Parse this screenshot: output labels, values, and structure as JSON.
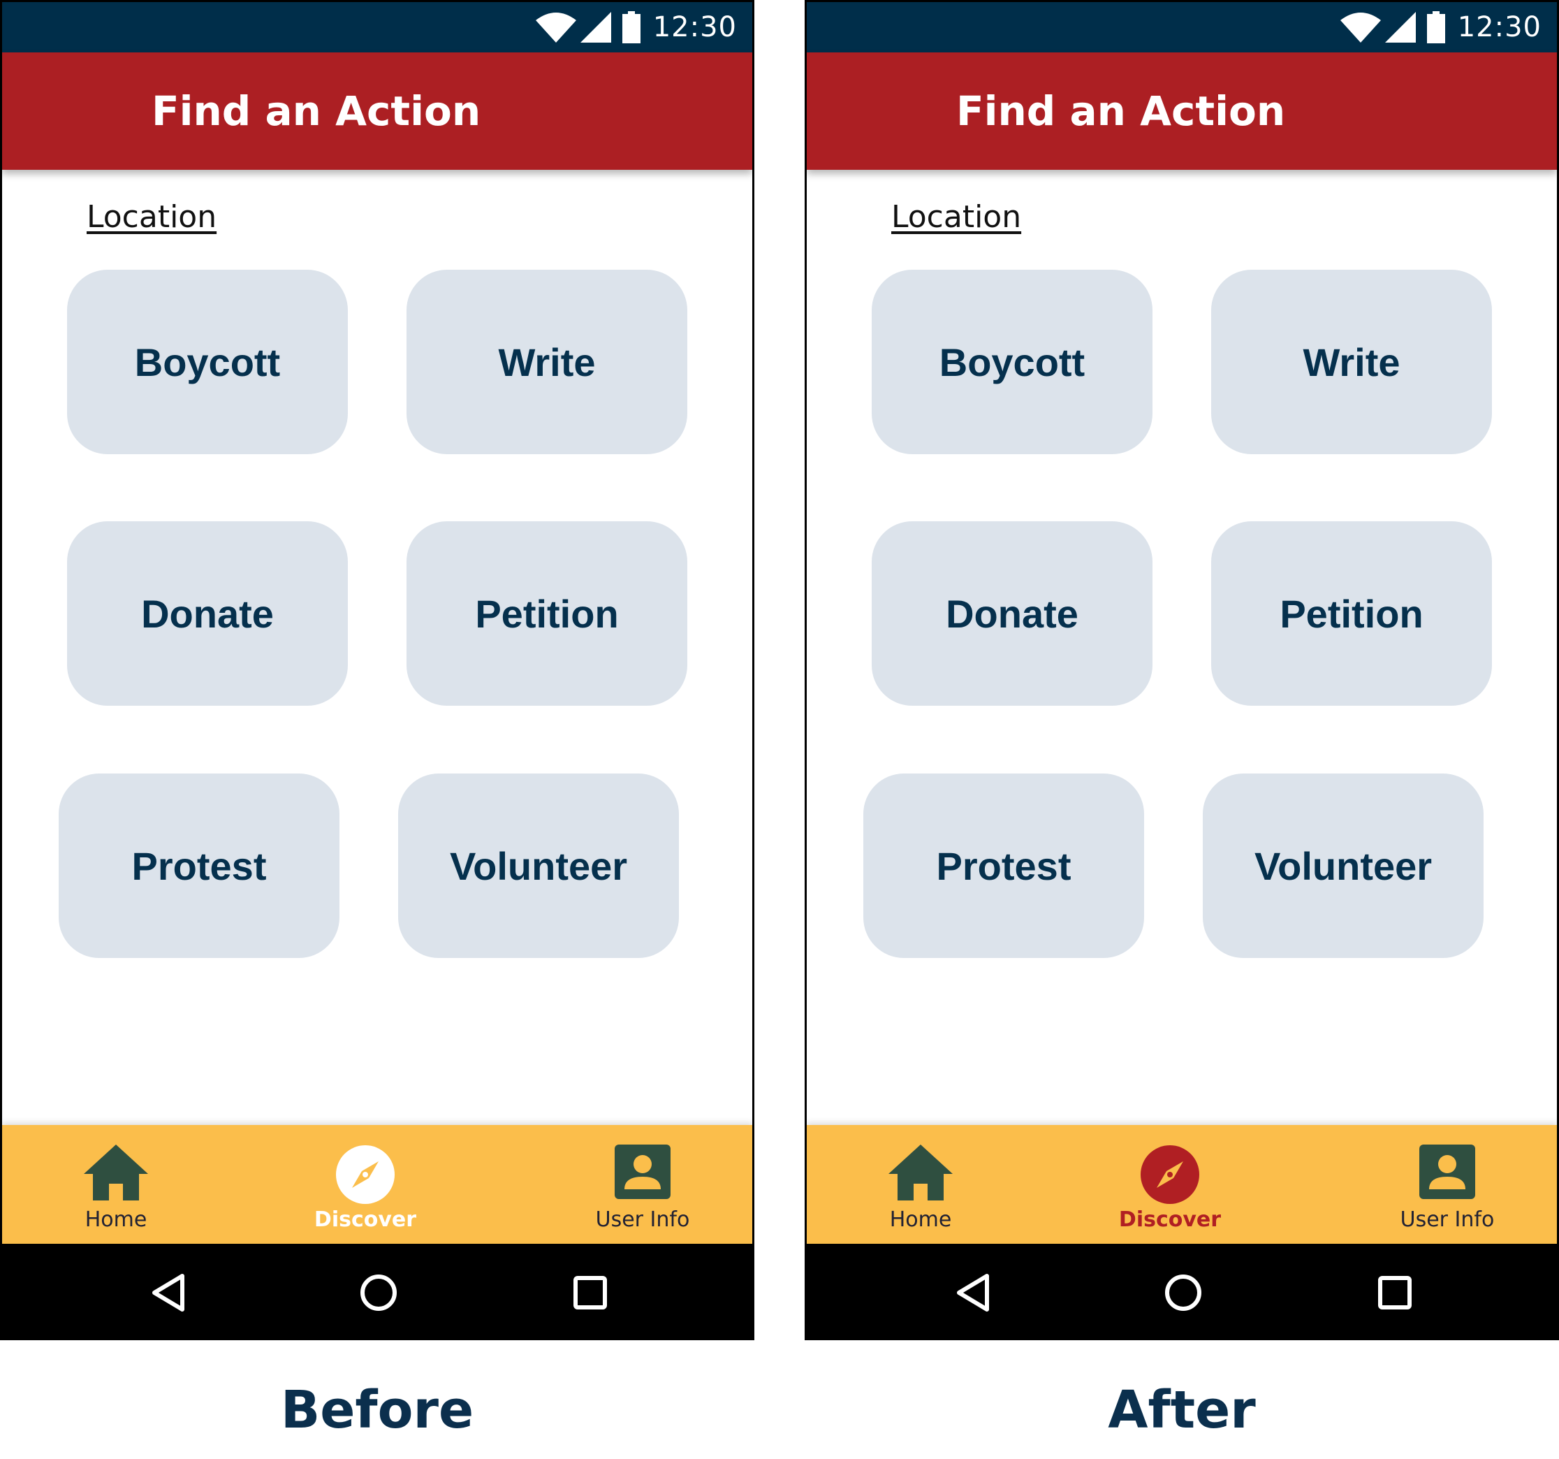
{
  "status_bar": {
    "time": "12:30"
  },
  "app_bar": {
    "title": "Find an Action"
  },
  "location_link": "Location",
  "actions": [
    "Boycott",
    "Write",
    "Donate",
    "Petition",
    "Protest",
    "Volunteer"
  ],
  "bottom_nav": {
    "home": "Home",
    "discover": "Discover",
    "user_info": "User Info",
    "active_item": "Discover"
  },
  "captions": {
    "before": "Before",
    "after": "After"
  },
  "colors": {
    "status_bar": "#002e4a",
    "app_bar": "#ac1f23",
    "tile": "#dce3eb",
    "tile_text": "#05304d",
    "bottom_nav": "#fbbe4b",
    "discover_active_before": "#ffffff",
    "discover_active_after": "#b01f23",
    "nav_icon": "#2f4f40"
  },
  "icons": {
    "wifi": "wifi-icon",
    "signal": "signal-icon",
    "battery": "battery-icon",
    "home": "home-icon",
    "discover": "compass-icon",
    "user_info": "account-box-icon",
    "back": "back-triangle-icon",
    "system_home": "home-circle-icon",
    "recents": "recents-square-icon"
  }
}
